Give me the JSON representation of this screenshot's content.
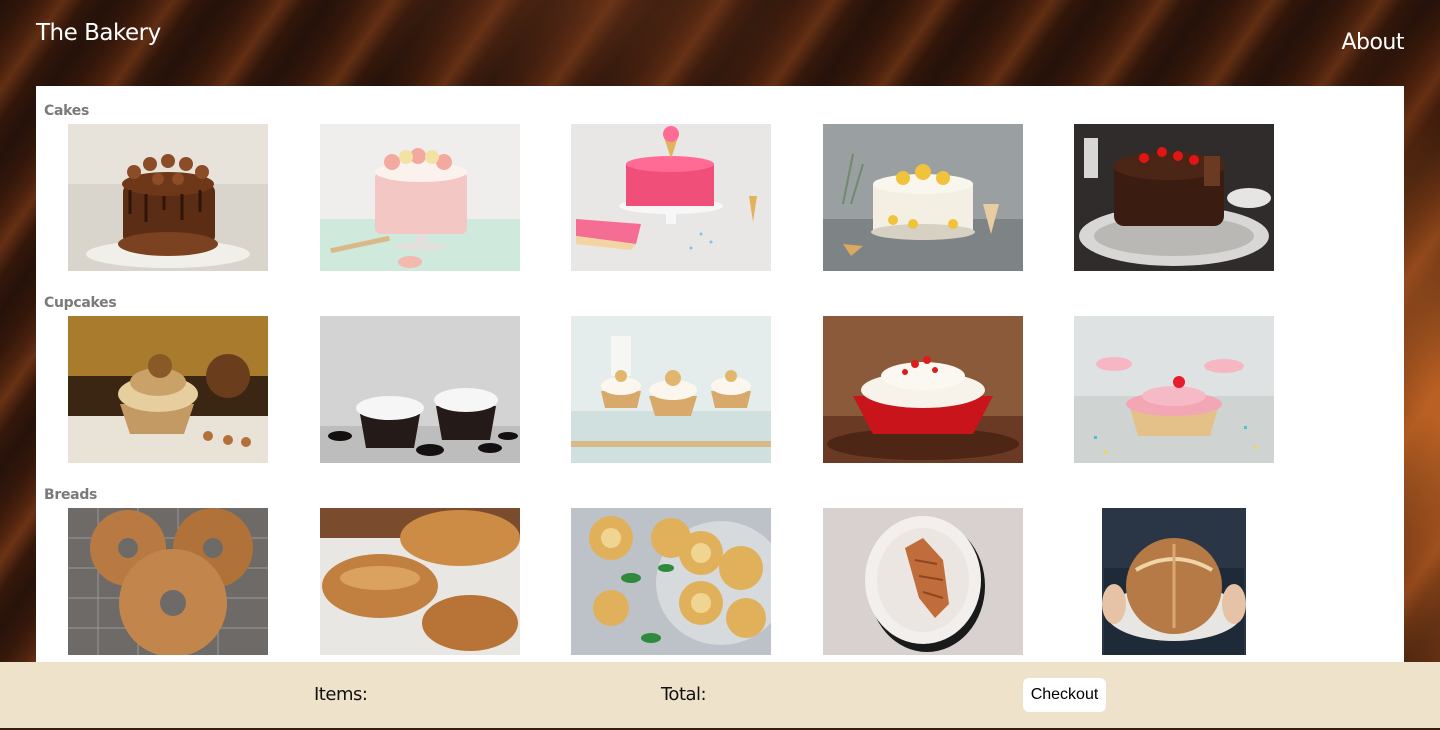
{
  "header": {
    "brand": "The Bakery",
    "nav_about": "About"
  },
  "sections": [
    {
      "title": "Cakes"
    },
    {
      "title": "Cupcakes"
    },
    {
      "title": "Breads"
    }
  ],
  "footer": {
    "items_label": "Items:",
    "total_label": "Total:",
    "checkout_label": "Checkout"
  },
  "colors": {
    "footer_bg": "#efe2cb",
    "panel_bg": "#ffffff",
    "section_title": "#7a7a7a"
  }
}
